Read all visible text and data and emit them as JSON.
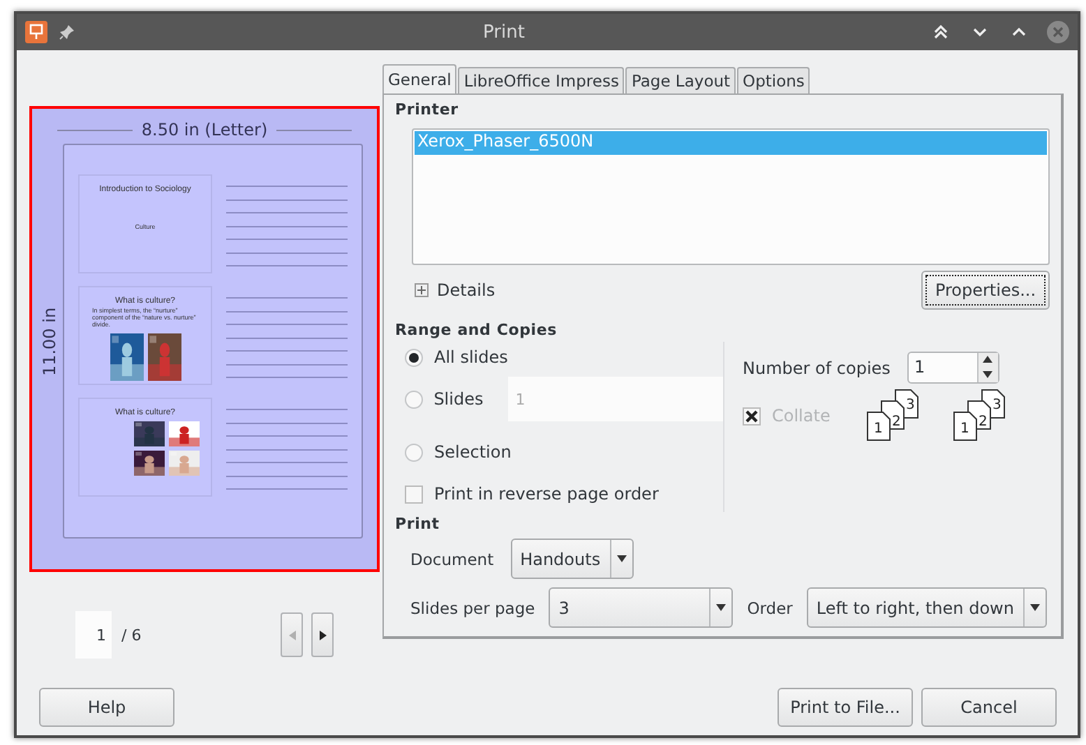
{
  "window": {
    "title": "Print"
  },
  "tabs": [
    {
      "label": "General",
      "selected": true
    },
    {
      "label": "LibreOffice Impress",
      "selected": false
    },
    {
      "label": "Page Layout",
      "selected": false
    },
    {
      "label": "Options",
      "selected": false
    }
  ],
  "preview": {
    "width_label": "8.50 in (Letter)",
    "height_label": "11.00 in",
    "slides": [
      {
        "title": "Introduction to Sociology",
        "subtitle": "Culture"
      },
      {
        "title": "What is culture?",
        "bullet": "In simplest terms, the “nurture” component of the “nature vs. nurture” divide."
      },
      {
        "title": "What is culture?"
      }
    ],
    "page": {
      "current": "1",
      "total": "/ 6"
    }
  },
  "printer": {
    "heading": "Printer",
    "printers": [
      {
        "name": "Xerox_Phaser_6500N",
        "selected": true
      }
    ],
    "details": "Details",
    "properties": "Properties..."
  },
  "range": {
    "heading": "Range and Copies",
    "options": [
      {
        "label": "All slides",
        "selected": true
      },
      {
        "label": "Slides",
        "selected": false,
        "value": "1"
      },
      {
        "label": "Selection",
        "selected": false
      }
    ],
    "reverse": {
      "label": "Print in reverse page order",
      "checked": false
    },
    "copies_label": "Number of copies",
    "copies": "1",
    "collate": {
      "label": "Collate",
      "checked": true,
      "disabled": true,
      "icons": [
        {
          "pages": [
            "1",
            "2",
            "3"
          ]
        },
        {
          "pages": [
            "1",
            "2",
            "3"
          ]
        }
      ]
    }
  },
  "print": {
    "heading": "Print",
    "document_label": "Document",
    "document": "Handouts",
    "slides_per_page_label": "Slides per page",
    "slides_per_page": "3",
    "order_label": "Order",
    "order": "Left to right, then down"
  },
  "buttons": [
    "Help",
    "Print to File...",
    "Cancel"
  ]
}
